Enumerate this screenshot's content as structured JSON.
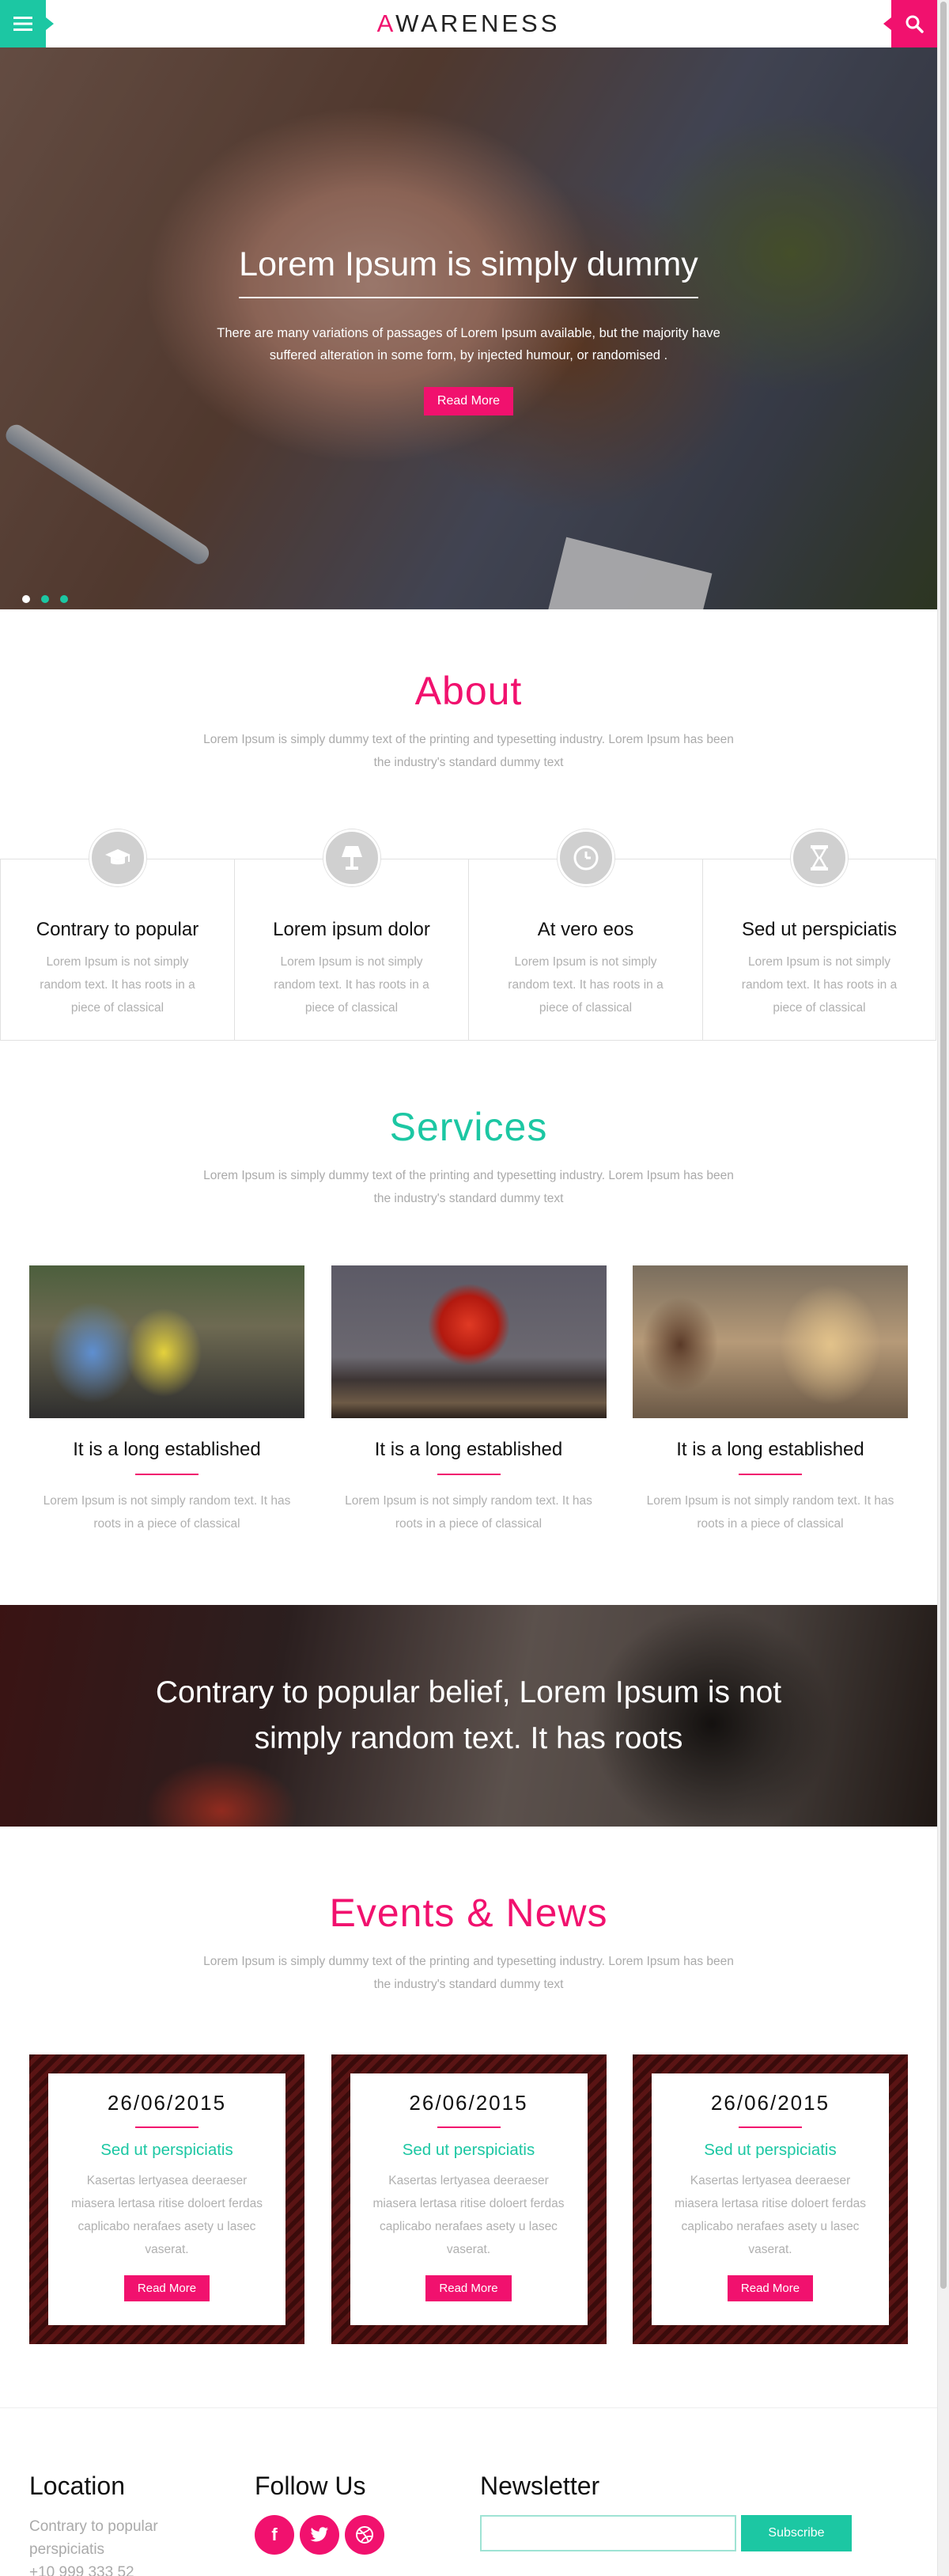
{
  "header": {
    "logo_first": "A",
    "logo_rest": "WARENESS"
  },
  "hero": {
    "title": "Lorem Ipsum is simply dummy",
    "text": "There are many variations of passages of Lorem Ipsum available, but the majority have suffered alteration in some form, by injected humour, or randomised .",
    "button": "Read More",
    "slides": 3,
    "active_slide": 1
  },
  "about": {
    "title": "About",
    "subtitle": "Lorem Ipsum is simply dummy text of the printing and typesetting industry. Lorem Ipsum has been the industry's standard dummy text",
    "features": [
      {
        "icon": "graduation-cap-icon",
        "title": "Contrary to popular",
        "text": "Lorem Ipsum is not simply random text. It has roots in a piece of classical"
      },
      {
        "icon": "lamp-icon",
        "title": "Lorem ipsum dolor",
        "text": "Lorem Ipsum is not simply random text. It has roots in a piece of classical"
      },
      {
        "icon": "clock-icon",
        "title": "At vero eos",
        "text": "Lorem Ipsum is not simply random text. It has roots in a piece of classical"
      },
      {
        "icon": "hourglass-icon",
        "title": "Sed ut perspiciatis",
        "text": "Lorem Ipsum is not simply random text. It has roots in a piece of classical"
      }
    ]
  },
  "services": {
    "title": "Services",
    "subtitle": "Lorem Ipsum is simply dummy text of the printing and typesetting industry. Lorem Ipsum has been the industry's standard dummy text",
    "items": [
      {
        "title": "It is a long established",
        "text": "Lorem Ipsum is not simply random text. It has roots in a piece of classical"
      },
      {
        "title": "It is a long established",
        "text": "Lorem Ipsum is not simply random text. It has roots in a piece of classical"
      },
      {
        "title": "It is a long established",
        "text": "Lorem Ipsum is not simply random text. It has roots in a piece of classical"
      }
    ]
  },
  "banner": {
    "text": "Contrary to popular belief, Lorem Ipsum is not simply random text. It has roots"
  },
  "events": {
    "title": "Events & News",
    "subtitle": "Lorem Ipsum is simply dummy text of the printing and typesetting industry. Lorem Ipsum has been the industry's standard dummy text",
    "items": [
      {
        "date": "26/06/2015",
        "title": "Sed ut perspiciatis",
        "text": "Kasertas lertyasea deeraeser miasera lertasa ritise doloert ferdas caplicabo nerafaes asety u lasec vaserat.",
        "button": "Read More"
      },
      {
        "date": "26/06/2015",
        "title": "Sed ut perspiciatis",
        "text": "Kasertas lertyasea deeraeser miasera lertasa ritise doloert ferdas caplicabo nerafaes asety u lasec vaserat.",
        "button": "Read More"
      },
      {
        "date": "26/06/2015",
        "title": "Sed ut perspiciatis",
        "text": "Kasertas lertyasea deeraeser miasera lertasa ritise doloert ferdas caplicabo nerafaes asety u lasec vaserat.",
        "button": "Read More"
      }
    ]
  },
  "footer": {
    "location_title": "Location",
    "location_text": "Contrary to popular perspiciatis",
    "phone": "+10 999 333 52",
    "follow_title": "Follow Us",
    "socials": [
      {
        "icon": "facebook-icon",
        "glyph": "f"
      },
      {
        "icon": "twitter-icon",
        "glyph": ""
      },
      {
        "icon": "dribbble-icon",
        "glyph": ""
      }
    ],
    "newsletter_title": "Newsletter",
    "newsletter_value": "",
    "subscribe": "Subscribe"
  },
  "colors": {
    "pink": "#f1116e",
    "teal": "#1cc7a3"
  }
}
